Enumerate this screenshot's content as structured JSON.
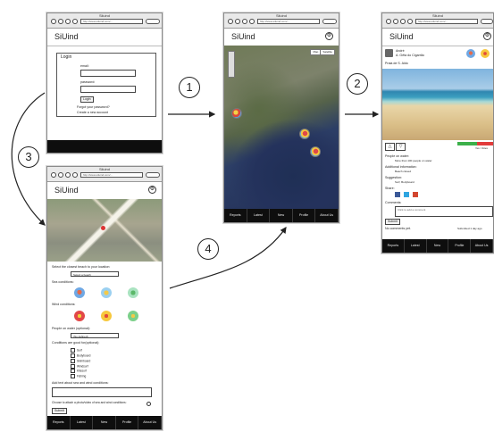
{
  "steps": [
    "1",
    "2",
    "3",
    "4"
  ],
  "browser": {
    "title": "Siluind",
    "url": "http://www.siluind.com/..."
  },
  "app_name": "SiUind",
  "login": {
    "heading": "Login",
    "email_label": "email:",
    "password_label": "password:",
    "login_button": "Login",
    "forgot_link": "Forgot your password?",
    "create_link": "Create a new account"
  },
  "map_screen": {
    "toggle_map": "Map",
    "toggle_satellite": "Satellite"
  },
  "tabs": [
    "Reports",
    "Latest",
    "New",
    "Profile",
    "About Us"
  ],
  "beach": {
    "user": "André",
    "place": "A. Gêta do Cigarrão",
    "caption": "Praia de S. Aldo",
    "people_label": "People on water:",
    "people_value": "More than 100 people on water",
    "additional_label": "Additional information:",
    "additional_value": "Beach closed",
    "suggestion_label": "Suggestion:",
    "suggestion_value": "Surf, Bodyboard",
    "share_label": "Share:",
    "comment_label": "Comments:",
    "comment_placeholder": "Click to add a comment",
    "submit": "Submit",
    "no_comments": "No comments yet.",
    "submitted": "Submitted 1 day ago",
    "bar_caption": "Yes / Votes"
  },
  "report": {
    "select_label": "Select the closest beach to your location:",
    "select_value": "Select a beach",
    "sea_label": "Sea conditions:",
    "wind_label": "Wind conditions:",
    "people_label": "People on water (optional):",
    "people_value": "(No defined)",
    "good_label": "Conditions are good for(optional):",
    "activities": [
      "Surf",
      "Bodyboard",
      "Skimboard",
      "Windsurf",
      "Kitesurf",
      "Fishing"
    ],
    "text_label": "Add text about sea and wind conditions:",
    "photo_label": "Choose to attach a photo/video of sea and wind conditions:",
    "submit": "Submit"
  }
}
